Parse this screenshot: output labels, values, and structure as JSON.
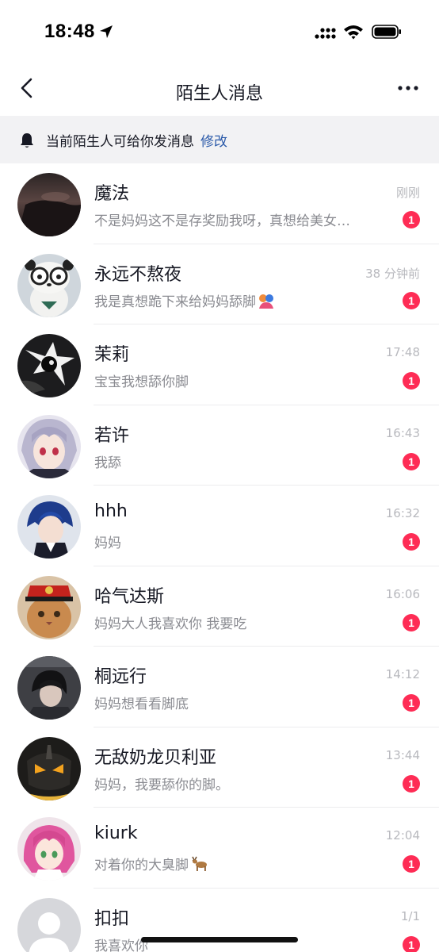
{
  "status": {
    "time": "18:48"
  },
  "nav": {
    "title": "陌生人消息"
  },
  "notice": {
    "text": "当前陌生人可给你发消息",
    "link": "修改"
  },
  "conversations": [
    {
      "name": "魔法",
      "time": "刚刚",
      "preview": "不是妈妈这不是存奖励我呀，真想给美女…",
      "badge": "1",
      "avatar": "dark-scene",
      "emoji": ""
    },
    {
      "name": "永远不熬夜",
      "time": "38 分钟前",
      "preview": "我是真想跪下来给妈妈舔脚",
      "badge": "1",
      "avatar": "panda-glasses",
      "emoji": "hug-emoji"
    },
    {
      "name": "茉莉",
      "time": "17:48",
      "preview": "宝宝我想舔你脚",
      "badge": "1",
      "avatar": "dark-creature",
      "emoji": ""
    },
    {
      "name": "若许",
      "time": "16:43",
      "preview": "我舔",
      "badge": "1",
      "avatar": "anime-silver-hair",
      "emoji": ""
    },
    {
      "name": "hhh",
      "time": "16:32",
      "preview": "妈妈",
      "badge": "1",
      "avatar": "anime-blue-hair",
      "emoji": ""
    },
    {
      "name": "哈气达斯",
      "time": "16:06",
      "preview": "妈妈大人我喜欢你  我要吃",
      "badge": "1",
      "avatar": "cat-red-hat",
      "emoji": ""
    },
    {
      "name": "桐远行",
      "time": "14:12",
      "preview": "妈妈想看看脚底",
      "badge": "1",
      "avatar": "person-dark",
      "emoji": ""
    },
    {
      "name": "无敌奶龙贝利亚",
      "time": "13:44",
      "preview": "妈妈，我要舔你的脚。",
      "badge": "1",
      "avatar": "dark-mask",
      "emoji": ""
    },
    {
      "name": "kiurk",
      "time": "12:04",
      "preview": "对着你的大臭脚",
      "badge": "1",
      "avatar": "anime-pink-hair",
      "emoji": "deer-emoji"
    },
    {
      "name": "扣扣",
      "time": "1/1",
      "preview": "我喜欢你",
      "badge": "1",
      "avatar": "default-person",
      "emoji": ""
    }
  ]
}
